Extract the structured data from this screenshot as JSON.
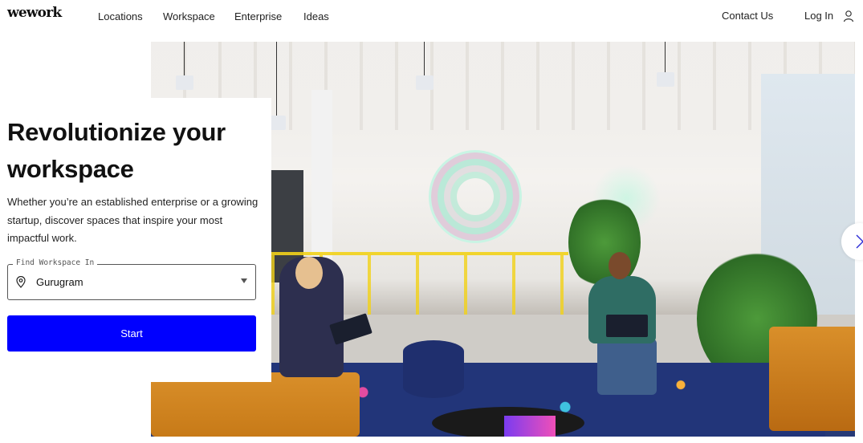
{
  "header": {
    "logo": "wework",
    "nav_left": [
      "Locations",
      "Workspace",
      "Enterprise",
      "Ideas"
    ],
    "nav_right": {
      "contact": "Contact Us",
      "login": "Log In",
      "user_icon": "user-icon"
    }
  },
  "hero": {
    "headline": "Revolutionize your workspace",
    "subtext": "Whether you’re an established enterprise or a growing startup, discover spaces that inspire your most impactful work.",
    "location_field": {
      "legend": "Find Workspace In",
      "icon": "map-pin-icon",
      "value": "Gurugram",
      "dropdown_icon": "caret-down-icon"
    },
    "start_button": "Start",
    "carousel_next_icon": "chevron-right-icon",
    "image_alt": "Office lounge with people working on laptops"
  },
  "colors": {
    "primary_button": "#0000ff",
    "text": "#111111",
    "background": "#ffffff"
  }
}
